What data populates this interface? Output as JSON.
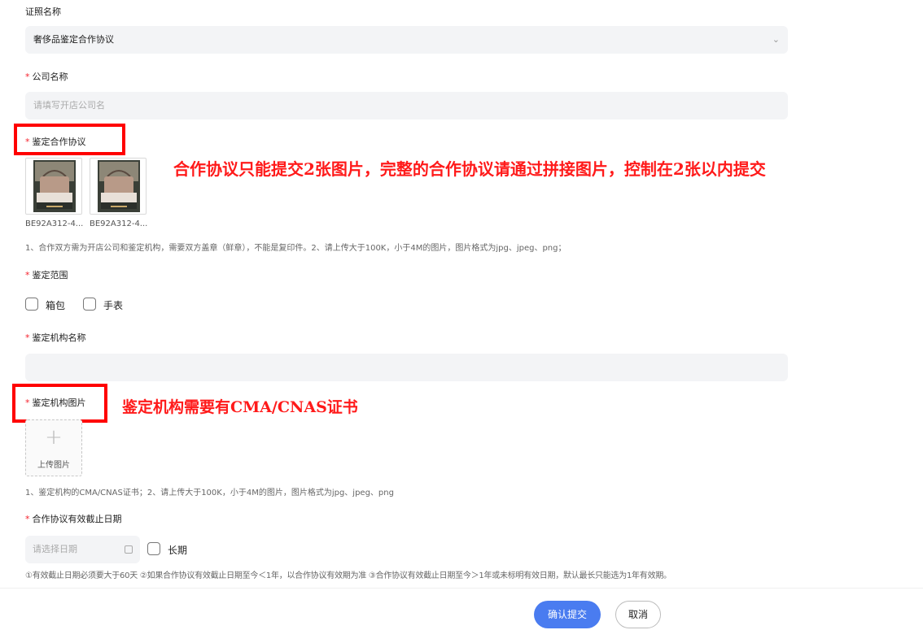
{
  "cert_name": {
    "label": "证照名称",
    "value": "奢侈品鉴定合作协议"
  },
  "company_name": {
    "required": "*",
    "label": "公司名称",
    "placeholder": "请填写开店公司名"
  },
  "agreement": {
    "required": "*",
    "label": "鉴定合作协议",
    "files": [
      {
        "name": "BE92A312-4..."
      },
      {
        "name": "BE92A312-4..."
      }
    ],
    "hint": "1、合作双方需为开店公司和鉴定机构，需要双方盖章（鲜章），不能是复印件。2、请上传大于100K，小于4M的图片，图片格式为jpg、jpeg、png；",
    "note": "合作协议只能提交2张图片，完整的合作协议请通过拼接图片，控制在2张以内提交"
  },
  "scope": {
    "required": "*",
    "label": "鉴定范围",
    "options": [
      "箱包",
      "手表"
    ]
  },
  "org_name": {
    "required": "*",
    "label": "鉴定机构名称"
  },
  "org_image": {
    "required": "*",
    "label": "鉴定机构图片",
    "upload_label": "上传图片",
    "plus": "+",
    "hint": "1、鉴定机构的CMA/CNAS证书；2、请上传大于100K，小于4M的图片，图片格式为jpg、jpeg、png",
    "note": "鉴定机构需要有CMA/CNAS证书"
  },
  "expiry": {
    "required": "*",
    "label": "合作协议有效截止日期",
    "placeholder": "请选择日期",
    "long_term": "长期",
    "hint": "①有效截止日期必须要大于60天 ②如果合作协议有效截止日期至今＜1年，以合作协议有效期为准 ③合作协议有效截止日期至今＞1年或未标明有效日期，默认最长只能选为1年有效期。"
  },
  "footer": {
    "confirm": "确认提交",
    "cancel": "取消"
  },
  "icons": {
    "select": "chevron-down-icon",
    "upload": "plus-icon",
    "date": "calendar-icon"
  },
  "colors": {
    "accent": "#4a7cf0",
    "required": "#f5222d",
    "annotation": "#ff1a1a"
  }
}
